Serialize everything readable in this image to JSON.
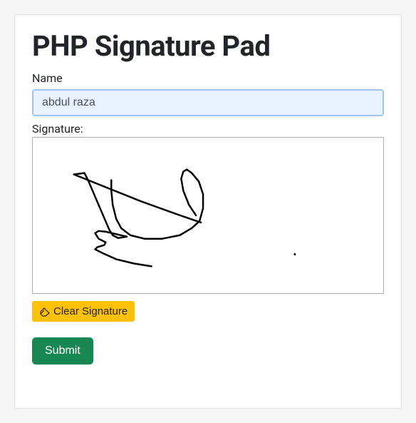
{
  "header": {
    "title": "PHP Signature Pad"
  },
  "form": {
    "name_label": "Name",
    "name_value": "abdul raza ",
    "signature_label": "Signature:",
    "clear_button": "Clear Signature",
    "submit_button": "Submit"
  }
}
